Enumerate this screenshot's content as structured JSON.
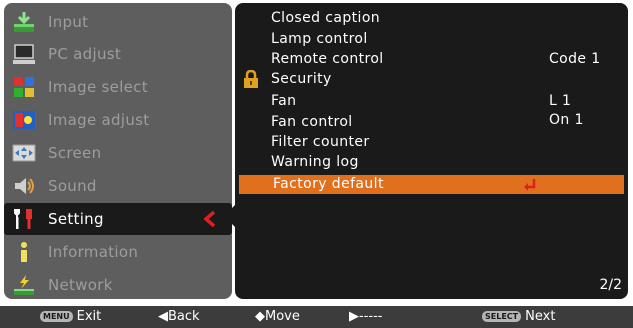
{
  "menu": {
    "items": [
      {
        "label": "Input",
        "icon": "input-icon"
      },
      {
        "label": "PC adjust",
        "icon": "pc-adjust-icon"
      },
      {
        "label": "Image select",
        "icon": "image-select-icon"
      },
      {
        "label": "Image adjust",
        "icon": "image-adjust-icon"
      },
      {
        "label": "Screen",
        "icon": "screen-icon"
      },
      {
        "label": "Sound",
        "icon": "sound-icon"
      },
      {
        "label": "Setting",
        "icon": "setting-icon",
        "active": true
      },
      {
        "label": "Information",
        "icon": "information-icon"
      },
      {
        "label": "Network",
        "icon": "network-icon"
      }
    ]
  },
  "settings": {
    "items": [
      {
        "label": "Closed caption",
        "value": ""
      },
      {
        "label": "Lamp control",
        "value": ""
      },
      {
        "label": "Remote control",
        "value": "Code 1"
      },
      {
        "label": "Security",
        "value": "",
        "icon": "lock-icon"
      },
      {
        "label": "Fan",
        "value": "L 1"
      },
      {
        "label": "Fan control",
        "value": "On 1"
      },
      {
        "label": "Filter counter",
        "value": ""
      },
      {
        "label": "Warning log",
        "value": ""
      },
      {
        "label": "Factory default",
        "value": "",
        "selected": true,
        "icon": "enter-icon"
      }
    ],
    "page": "2/2"
  },
  "bottom_bar": {
    "exit_key": "MENU",
    "exit_label": "Exit",
    "back_label": "◀Back",
    "move_label": "◆Move",
    "dash_label": "▶-----",
    "next_key": "SELECT",
    "next_label": "Next"
  },
  "colors": {
    "highlight": "#e0701e",
    "menu_bg": "#5e5e5e",
    "panel_bg": "#1a1a1a",
    "active_arrow": "#e02020"
  }
}
